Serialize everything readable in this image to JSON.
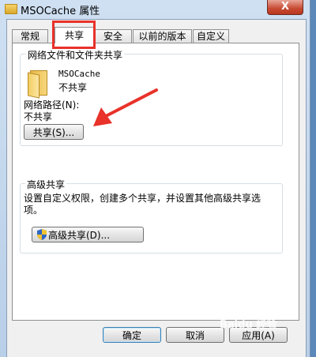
{
  "window": {
    "title": "MSOCache 属性",
    "close_label": "X"
  },
  "tabs": [
    {
      "label": "常规"
    },
    {
      "label": "共享"
    },
    {
      "label": "安全"
    },
    {
      "label": "以前的版本"
    },
    {
      "label": "自定义"
    }
  ],
  "network_share": {
    "group_title": "网络文件和文件夹共享",
    "folder_name": "MSOCache",
    "folder_status": "不共享",
    "path_label": "网络路径(N):",
    "path_value": "不共享",
    "share_button": "共享(S)..."
  },
  "advanced_share": {
    "group_title": "高级共享",
    "description": "设置自定义权限，创建多个共享，并设置其他高级共享选项。",
    "button": "高级共享(D)..."
  },
  "footer": {
    "ok": "确定",
    "cancel": "取消",
    "apply": "应用(A)"
  },
  "annotations": {
    "highlight_color": "#e8322a",
    "arrow_color": "#e8322a"
  },
  "watermark": {
    "text": "Baidu 经验"
  }
}
